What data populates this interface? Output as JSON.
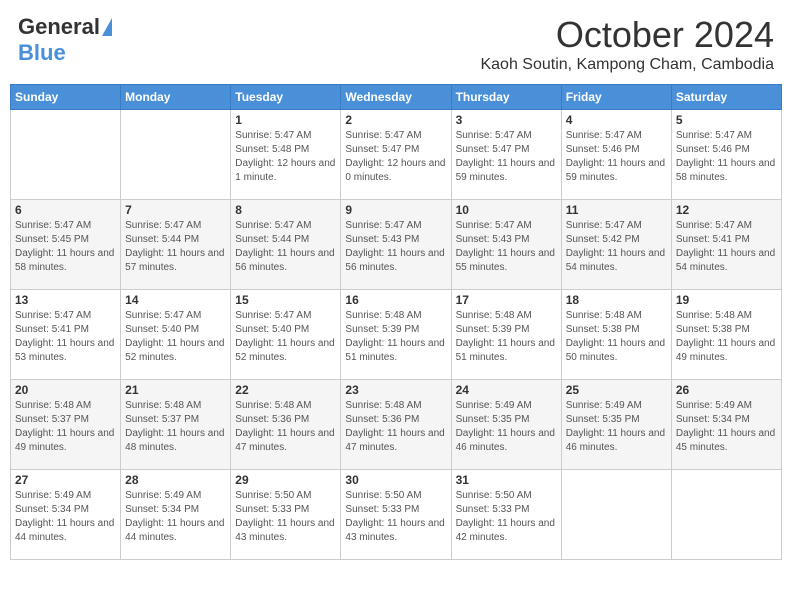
{
  "header": {
    "logo_general": "General",
    "logo_blue": "Blue",
    "month_title": "October 2024",
    "subtitle": "Kaoh Soutin, Kampong Cham, Cambodia"
  },
  "days_of_week": [
    "Sunday",
    "Monday",
    "Tuesday",
    "Wednesday",
    "Thursday",
    "Friday",
    "Saturday"
  ],
  "weeks": [
    [
      {
        "day": "",
        "info": ""
      },
      {
        "day": "",
        "info": ""
      },
      {
        "day": "1",
        "info": "Sunrise: 5:47 AM\nSunset: 5:48 PM\nDaylight: 12 hours and 1 minute."
      },
      {
        "day": "2",
        "info": "Sunrise: 5:47 AM\nSunset: 5:47 PM\nDaylight: 12 hours and 0 minutes."
      },
      {
        "day": "3",
        "info": "Sunrise: 5:47 AM\nSunset: 5:47 PM\nDaylight: 11 hours and 59 minutes."
      },
      {
        "day": "4",
        "info": "Sunrise: 5:47 AM\nSunset: 5:46 PM\nDaylight: 11 hours and 59 minutes."
      },
      {
        "day": "5",
        "info": "Sunrise: 5:47 AM\nSunset: 5:46 PM\nDaylight: 11 hours and 58 minutes."
      }
    ],
    [
      {
        "day": "6",
        "info": "Sunrise: 5:47 AM\nSunset: 5:45 PM\nDaylight: 11 hours and 58 minutes."
      },
      {
        "day": "7",
        "info": "Sunrise: 5:47 AM\nSunset: 5:44 PM\nDaylight: 11 hours and 57 minutes."
      },
      {
        "day": "8",
        "info": "Sunrise: 5:47 AM\nSunset: 5:44 PM\nDaylight: 11 hours and 56 minutes."
      },
      {
        "day": "9",
        "info": "Sunrise: 5:47 AM\nSunset: 5:43 PM\nDaylight: 11 hours and 56 minutes."
      },
      {
        "day": "10",
        "info": "Sunrise: 5:47 AM\nSunset: 5:43 PM\nDaylight: 11 hours and 55 minutes."
      },
      {
        "day": "11",
        "info": "Sunrise: 5:47 AM\nSunset: 5:42 PM\nDaylight: 11 hours and 54 minutes."
      },
      {
        "day": "12",
        "info": "Sunrise: 5:47 AM\nSunset: 5:41 PM\nDaylight: 11 hours and 54 minutes."
      }
    ],
    [
      {
        "day": "13",
        "info": "Sunrise: 5:47 AM\nSunset: 5:41 PM\nDaylight: 11 hours and 53 minutes."
      },
      {
        "day": "14",
        "info": "Sunrise: 5:47 AM\nSunset: 5:40 PM\nDaylight: 11 hours and 52 minutes."
      },
      {
        "day": "15",
        "info": "Sunrise: 5:47 AM\nSunset: 5:40 PM\nDaylight: 11 hours and 52 minutes."
      },
      {
        "day": "16",
        "info": "Sunrise: 5:48 AM\nSunset: 5:39 PM\nDaylight: 11 hours and 51 minutes."
      },
      {
        "day": "17",
        "info": "Sunrise: 5:48 AM\nSunset: 5:39 PM\nDaylight: 11 hours and 51 minutes."
      },
      {
        "day": "18",
        "info": "Sunrise: 5:48 AM\nSunset: 5:38 PM\nDaylight: 11 hours and 50 minutes."
      },
      {
        "day": "19",
        "info": "Sunrise: 5:48 AM\nSunset: 5:38 PM\nDaylight: 11 hours and 49 minutes."
      }
    ],
    [
      {
        "day": "20",
        "info": "Sunrise: 5:48 AM\nSunset: 5:37 PM\nDaylight: 11 hours and 49 minutes."
      },
      {
        "day": "21",
        "info": "Sunrise: 5:48 AM\nSunset: 5:37 PM\nDaylight: 11 hours and 48 minutes."
      },
      {
        "day": "22",
        "info": "Sunrise: 5:48 AM\nSunset: 5:36 PM\nDaylight: 11 hours and 47 minutes."
      },
      {
        "day": "23",
        "info": "Sunrise: 5:48 AM\nSunset: 5:36 PM\nDaylight: 11 hours and 47 minutes."
      },
      {
        "day": "24",
        "info": "Sunrise: 5:49 AM\nSunset: 5:35 PM\nDaylight: 11 hours and 46 minutes."
      },
      {
        "day": "25",
        "info": "Sunrise: 5:49 AM\nSunset: 5:35 PM\nDaylight: 11 hours and 46 minutes."
      },
      {
        "day": "26",
        "info": "Sunrise: 5:49 AM\nSunset: 5:34 PM\nDaylight: 11 hours and 45 minutes."
      }
    ],
    [
      {
        "day": "27",
        "info": "Sunrise: 5:49 AM\nSunset: 5:34 PM\nDaylight: 11 hours and 44 minutes."
      },
      {
        "day": "28",
        "info": "Sunrise: 5:49 AM\nSunset: 5:34 PM\nDaylight: 11 hours and 44 minutes."
      },
      {
        "day": "29",
        "info": "Sunrise: 5:50 AM\nSunset: 5:33 PM\nDaylight: 11 hours and 43 minutes."
      },
      {
        "day": "30",
        "info": "Sunrise: 5:50 AM\nSunset: 5:33 PM\nDaylight: 11 hours and 43 minutes."
      },
      {
        "day": "31",
        "info": "Sunrise: 5:50 AM\nSunset: 5:33 PM\nDaylight: 11 hours and 42 minutes."
      },
      {
        "day": "",
        "info": ""
      },
      {
        "day": "",
        "info": ""
      }
    ]
  ]
}
